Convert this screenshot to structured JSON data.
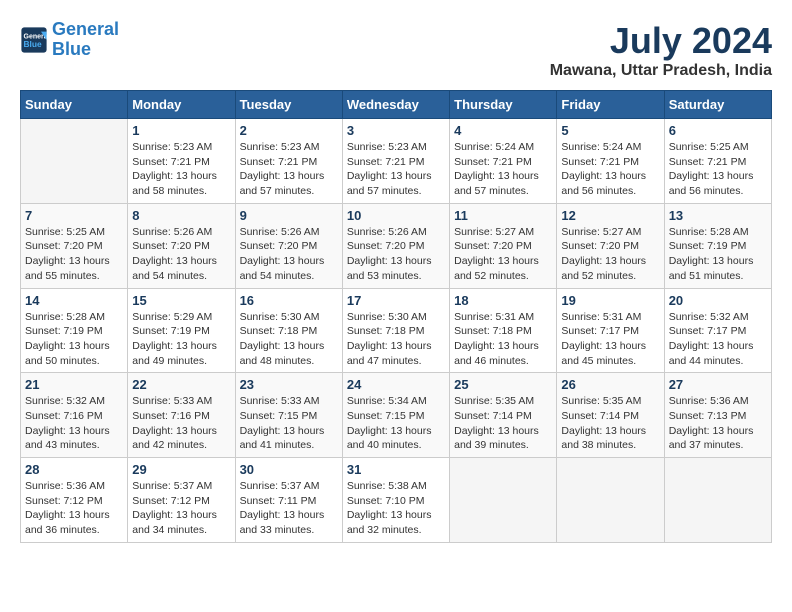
{
  "logo": {
    "line1": "General",
    "line2": "Blue"
  },
  "title": "July 2024",
  "subtitle": "Mawana, Uttar Pradesh, India",
  "days_header": [
    "Sunday",
    "Monday",
    "Tuesday",
    "Wednesday",
    "Thursday",
    "Friday",
    "Saturday"
  ],
  "weeks": [
    [
      {
        "date": "",
        "info": ""
      },
      {
        "date": "1",
        "info": "Sunrise: 5:23 AM\nSunset: 7:21 PM\nDaylight: 13 hours\nand 58 minutes."
      },
      {
        "date": "2",
        "info": "Sunrise: 5:23 AM\nSunset: 7:21 PM\nDaylight: 13 hours\nand 57 minutes."
      },
      {
        "date": "3",
        "info": "Sunrise: 5:23 AM\nSunset: 7:21 PM\nDaylight: 13 hours\nand 57 minutes."
      },
      {
        "date": "4",
        "info": "Sunrise: 5:24 AM\nSunset: 7:21 PM\nDaylight: 13 hours\nand 57 minutes."
      },
      {
        "date": "5",
        "info": "Sunrise: 5:24 AM\nSunset: 7:21 PM\nDaylight: 13 hours\nand 56 minutes."
      },
      {
        "date": "6",
        "info": "Sunrise: 5:25 AM\nSunset: 7:21 PM\nDaylight: 13 hours\nand 56 minutes."
      }
    ],
    [
      {
        "date": "7",
        "info": "Sunrise: 5:25 AM\nSunset: 7:20 PM\nDaylight: 13 hours\nand 55 minutes."
      },
      {
        "date": "8",
        "info": "Sunrise: 5:26 AM\nSunset: 7:20 PM\nDaylight: 13 hours\nand 54 minutes."
      },
      {
        "date": "9",
        "info": "Sunrise: 5:26 AM\nSunset: 7:20 PM\nDaylight: 13 hours\nand 54 minutes."
      },
      {
        "date": "10",
        "info": "Sunrise: 5:26 AM\nSunset: 7:20 PM\nDaylight: 13 hours\nand 53 minutes."
      },
      {
        "date": "11",
        "info": "Sunrise: 5:27 AM\nSunset: 7:20 PM\nDaylight: 13 hours\nand 52 minutes."
      },
      {
        "date": "12",
        "info": "Sunrise: 5:27 AM\nSunset: 7:20 PM\nDaylight: 13 hours\nand 52 minutes."
      },
      {
        "date": "13",
        "info": "Sunrise: 5:28 AM\nSunset: 7:19 PM\nDaylight: 13 hours\nand 51 minutes."
      }
    ],
    [
      {
        "date": "14",
        "info": "Sunrise: 5:28 AM\nSunset: 7:19 PM\nDaylight: 13 hours\nand 50 minutes."
      },
      {
        "date": "15",
        "info": "Sunrise: 5:29 AM\nSunset: 7:19 PM\nDaylight: 13 hours\nand 49 minutes."
      },
      {
        "date": "16",
        "info": "Sunrise: 5:30 AM\nSunset: 7:18 PM\nDaylight: 13 hours\nand 48 minutes."
      },
      {
        "date": "17",
        "info": "Sunrise: 5:30 AM\nSunset: 7:18 PM\nDaylight: 13 hours\nand 47 minutes."
      },
      {
        "date": "18",
        "info": "Sunrise: 5:31 AM\nSunset: 7:18 PM\nDaylight: 13 hours\nand 46 minutes."
      },
      {
        "date": "19",
        "info": "Sunrise: 5:31 AM\nSunset: 7:17 PM\nDaylight: 13 hours\nand 45 minutes."
      },
      {
        "date": "20",
        "info": "Sunrise: 5:32 AM\nSunset: 7:17 PM\nDaylight: 13 hours\nand 44 minutes."
      }
    ],
    [
      {
        "date": "21",
        "info": "Sunrise: 5:32 AM\nSunset: 7:16 PM\nDaylight: 13 hours\nand 43 minutes."
      },
      {
        "date": "22",
        "info": "Sunrise: 5:33 AM\nSunset: 7:16 PM\nDaylight: 13 hours\nand 42 minutes."
      },
      {
        "date": "23",
        "info": "Sunrise: 5:33 AM\nSunset: 7:15 PM\nDaylight: 13 hours\nand 41 minutes."
      },
      {
        "date": "24",
        "info": "Sunrise: 5:34 AM\nSunset: 7:15 PM\nDaylight: 13 hours\nand 40 minutes."
      },
      {
        "date": "25",
        "info": "Sunrise: 5:35 AM\nSunset: 7:14 PM\nDaylight: 13 hours\nand 39 minutes."
      },
      {
        "date": "26",
        "info": "Sunrise: 5:35 AM\nSunset: 7:14 PM\nDaylight: 13 hours\nand 38 minutes."
      },
      {
        "date": "27",
        "info": "Sunrise: 5:36 AM\nSunset: 7:13 PM\nDaylight: 13 hours\nand 37 minutes."
      }
    ],
    [
      {
        "date": "28",
        "info": "Sunrise: 5:36 AM\nSunset: 7:12 PM\nDaylight: 13 hours\nand 36 minutes."
      },
      {
        "date": "29",
        "info": "Sunrise: 5:37 AM\nSunset: 7:12 PM\nDaylight: 13 hours\nand 34 minutes."
      },
      {
        "date": "30",
        "info": "Sunrise: 5:37 AM\nSunset: 7:11 PM\nDaylight: 13 hours\nand 33 minutes."
      },
      {
        "date": "31",
        "info": "Sunrise: 5:38 AM\nSunset: 7:10 PM\nDaylight: 13 hours\nand 32 minutes."
      },
      {
        "date": "",
        "info": ""
      },
      {
        "date": "",
        "info": ""
      },
      {
        "date": "",
        "info": ""
      }
    ]
  ]
}
